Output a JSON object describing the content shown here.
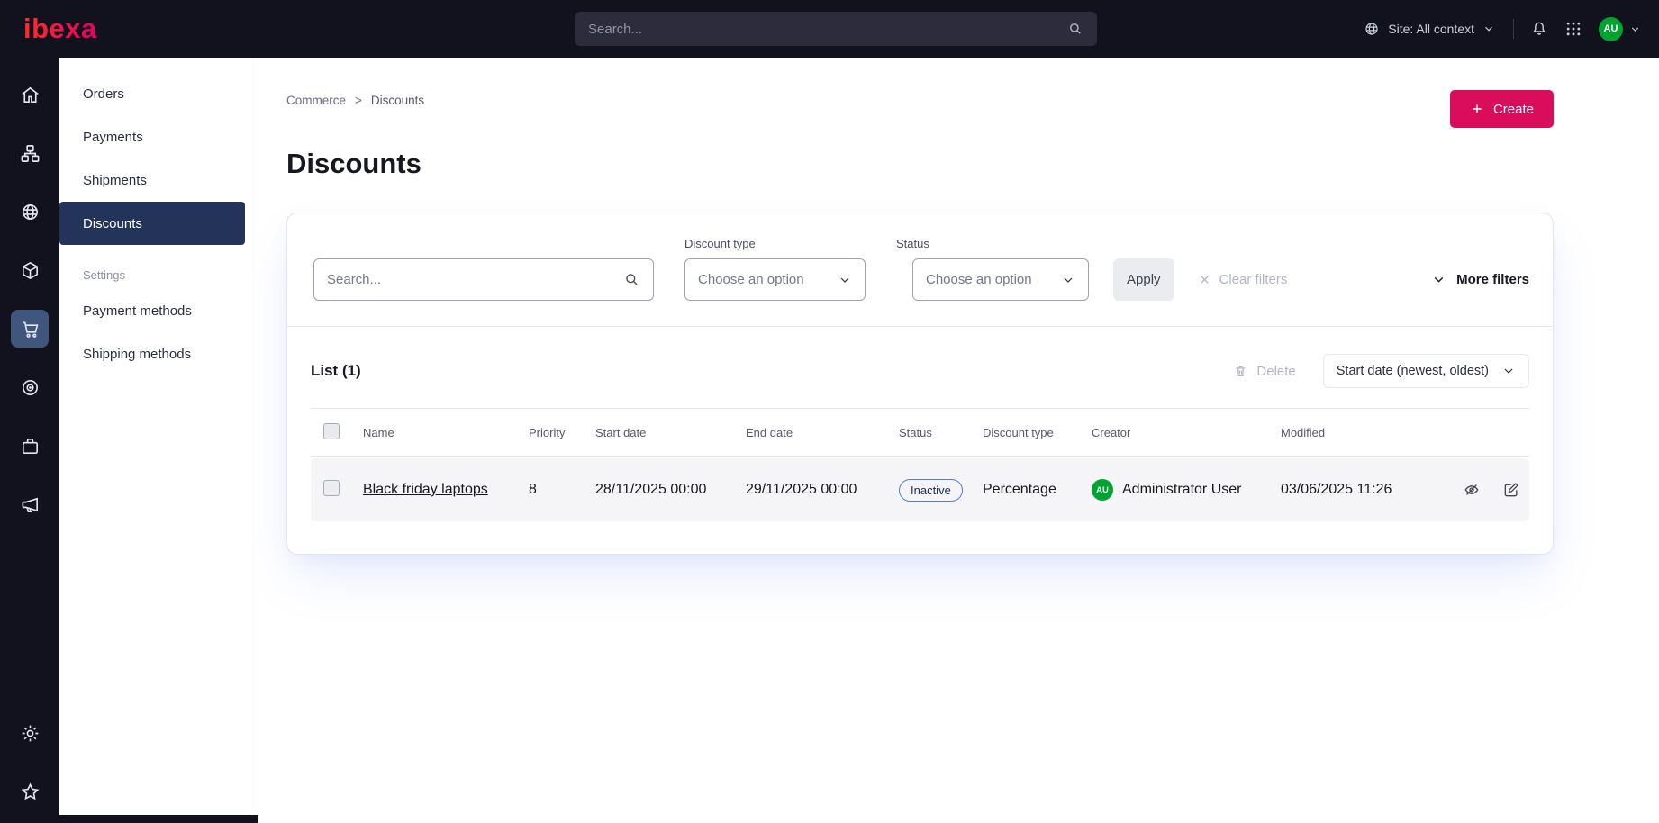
{
  "topbar": {
    "logo_text": "ibexa",
    "search_placeholder": "Search...",
    "site_context_label": "Site: All context",
    "avatar_initials": "AU"
  },
  "icon_rail": {
    "icons": [
      "home",
      "site-structure",
      "globe",
      "product-catalog",
      "commerce-cart",
      "target",
      "briefcase",
      "megaphone",
      "settings-gear",
      "bookmarks-star"
    ],
    "active_icon": "commerce-cart"
  },
  "sidebar": {
    "items": [
      "Orders",
      "Payments",
      "Shipments",
      "Discounts"
    ],
    "active_item": "Discounts",
    "section_label": "Settings",
    "settings_items": [
      "Payment methods",
      "Shipping methods"
    ]
  },
  "breadcrumb": {
    "items": [
      "Commerce",
      "Discounts"
    ],
    "separator": ">"
  },
  "page": {
    "title": "Discounts",
    "create_button": "Create"
  },
  "filters": {
    "search_placeholder": "Search...",
    "discount_type": {
      "label": "Discount type",
      "value": "Choose an option"
    },
    "status": {
      "label": "Status",
      "value": "Choose an option"
    },
    "apply_button": "Apply",
    "clear_filters": "Clear filters",
    "more_filters": "More filters"
  },
  "list": {
    "title": "List (1)",
    "delete_button": "Delete",
    "sort_dropdown": "Start date (newest, oldest)",
    "columns": [
      "Name",
      "Priority",
      "Start date",
      "End date",
      "Status",
      "Discount type",
      "Creator",
      "Modified"
    ],
    "rows": [
      {
        "name": "Black friday laptops",
        "priority": "8",
        "start_date": "28/11/2025 00:00",
        "end_date": "29/11/2025 00:00",
        "status": "Inactive",
        "discount_type": "Percentage",
        "creator_initials": "AU",
        "creator_name": "Administrator User",
        "modified": "03/06/2025 11:26"
      }
    ]
  },
  "colors": {
    "brand_pink": "#d90d5c",
    "topbar_bg": "#12121f",
    "sidebar_active_bg": "#24335a",
    "rail_active_bg": "#41567c",
    "inactive_badge_border": "#4c7fd9",
    "avatar_green": "#00a230",
    "row_bg": "#f5f5f7"
  }
}
